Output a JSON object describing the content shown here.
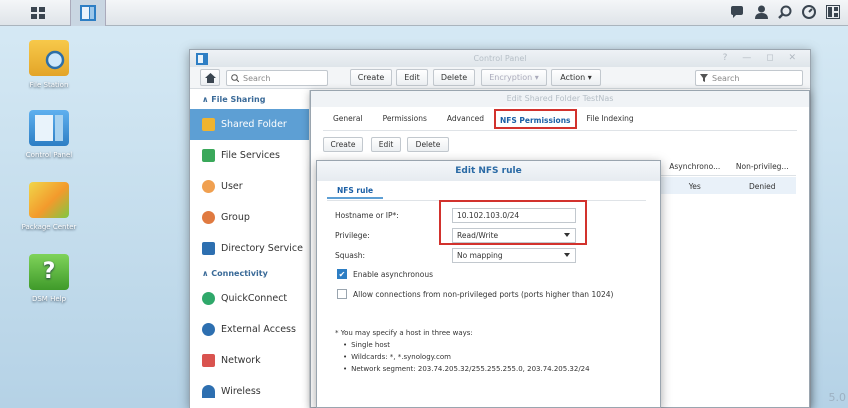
{
  "desktop": {
    "icons": [
      {
        "label": "File Station"
      },
      {
        "label": "Control Panel"
      },
      {
        "label": "Package Center"
      },
      {
        "label": "DSM Help"
      }
    ],
    "help_glyph": "?"
  },
  "window": {
    "title": "Control Panel",
    "controls": "? — ◻ ✕",
    "search_placeholder": "Search",
    "toolbar": {
      "create": "Create",
      "edit": "Edit",
      "delete": "Delete",
      "encryption": "Encryption ▾",
      "action": "Action ▾",
      "filter_placeholder": "Search"
    }
  },
  "sidebar": {
    "sections": [
      {
        "title": "File Sharing",
        "items": [
          "Shared Folder",
          "File Services",
          "User",
          "Group",
          "Directory Service"
        ]
      },
      {
        "title": "Connectivity",
        "items": [
          "QuickConnect",
          "External Access",
          "Network",
          "Wireless"
        ]
      }
    ],
    "collapse_glyph": "∧"
  },
  "edit_shared_folder": {
    "title": "Edit Shared Folder TestNas",
    "tabs": [
      "General",
      "Permissions",
      "Advanced",
      "NFS Permissions",
      "File Indexing"
    ],
    "selected_tab": "NFS Permissions",
    "buttons": {
      "create": "Create",
      "edit": "Edit",
      "delete": "Delete"
    },
    "table": {
      "headers": [
        "Asynchrono...",
        "Non-privileg..."
      ],
      "row": [
        "Yes",
        "Denied"
      ]
    }
  },
  "nfs_rule": {
    "title": "Edit NFS rule",
    "tab": "NFS rule",
    "hostname_label": "Hostname or IP*:",
    "hostname_value": "10.102.103.0/24",
    "privilege_label": "Privilege:",
    "privilege_value": "Read/Write",
    "squash_label": "Squash:",
    "squash_value": "No mapping",
    "async_label": "Enable asynchronous",
    "async_checked": true,
    "nonpriv_label": "Allow connections from non-privileged ports (ports higher than 1024)",
    "nonpriv_checked": false,
    "check_glyph": "✔",
    "note_title": "* You may specify a host in three ways:",
    "note_items": [
      "Single host",
      "Wildcards: *, *.synology.com",
      "Network segment: 203.74.205.32/255.255.255.0, 203.74.205.32/24"
    ]
  },
  "watermark": "5.0"
}
